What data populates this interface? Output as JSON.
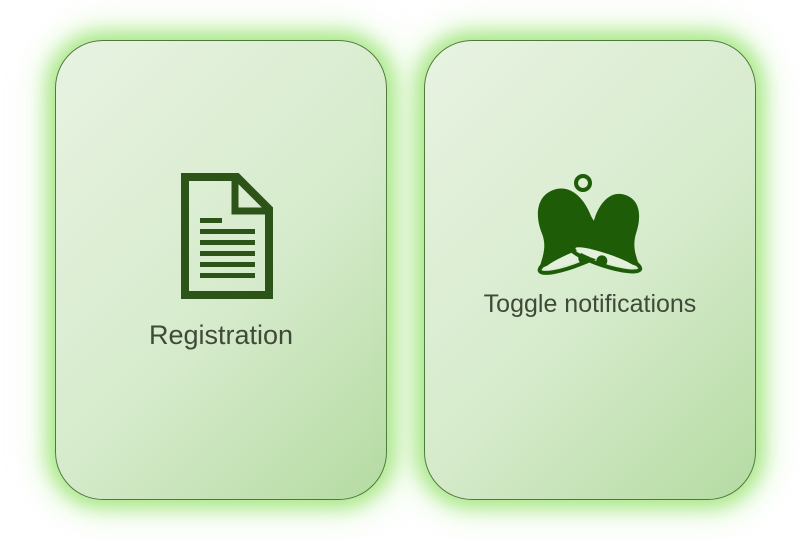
{
  "tiles": {
    "registration": {
      "label": "Registration",
      "icon": "document-icon"
    },
    "notifications": {
      "label": "Toggle notifications",
      "icon": "bell-icon"
    }
  },
  "colors": {
    "tile_border": "#4f7a3e",
    "tile_glow": "#96e16e",
    "icon": "#1e5c08",
    "doc_icon": "#2d5418",
    "label_text": "#3f4a38"
  }
}
